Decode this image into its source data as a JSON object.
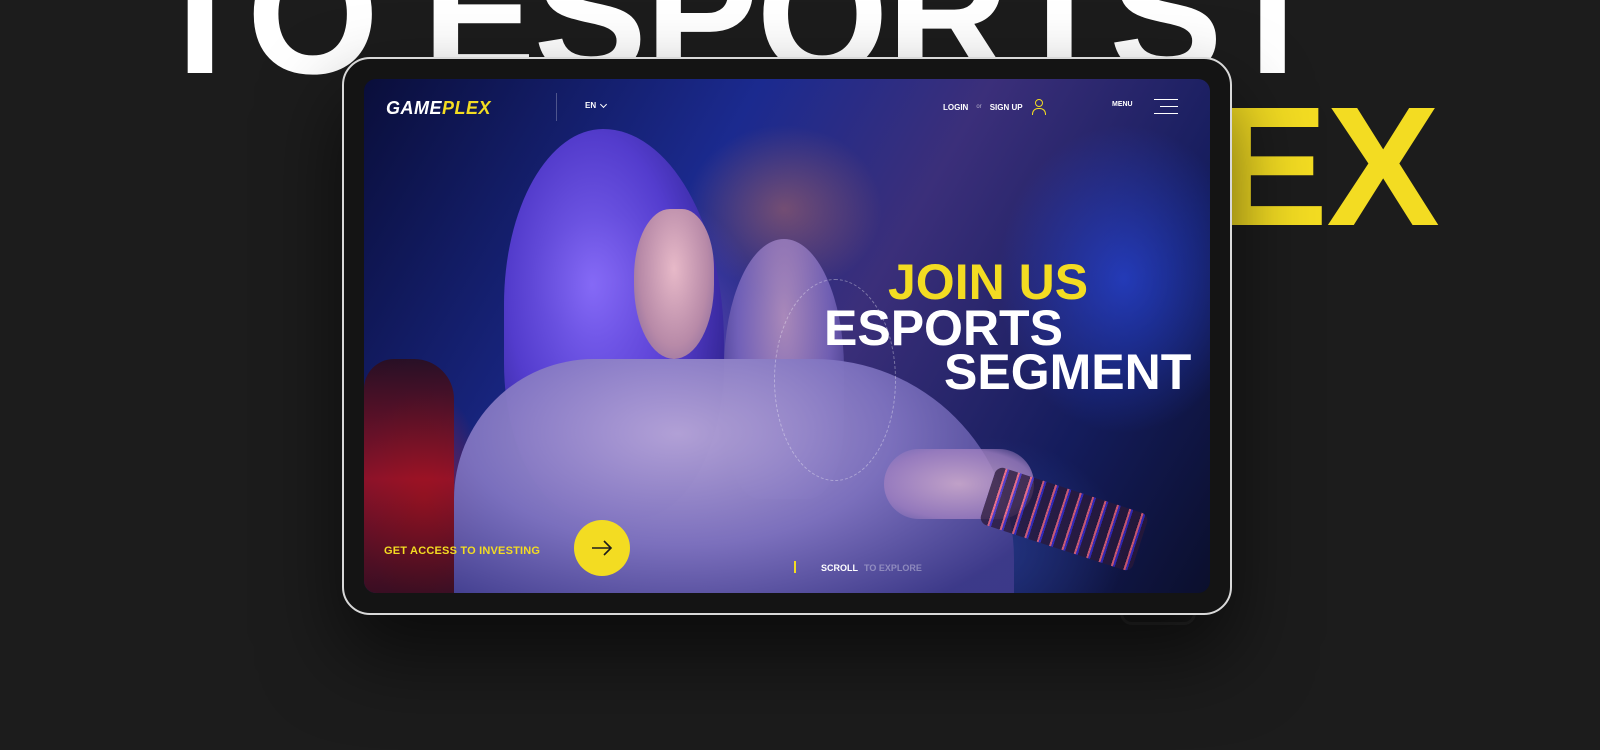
{
  "background": {
    "headline_white": "TO ESPORTST",
    "headline_yellow": "EX"
  },
  "header": {
    "logo_part1": "GAME",
    "logo_part2": "PLEX",
    "language": "EN",
    "login": "LOGIN",
    "or": "or",
    "signup": "SIGN UP",
    "menu": "MENU"
  },
  "hero": {
    "line1": "JOIN US",
    "line2": "ESPORTS",
    "line3": "SEGMENT"
  },
  "cta": {
    "label": "GET ACCESS TO INVESTING"
  },
  "scroll": {
    "label": "SCROLL",
    "hint": "TO EXPLORE"
  },
  "colors": {
    "accent": "#f3dc22",
    "background": "#1c1c1c",
    "text": "#ffffff"
  },
  "icons": {
    "user": "user-icon",
    "menu": "hamburger-icon",
    "arrow": "arrow-right-icon",
    "chevron": "chevron-down-icon"
  }
}
